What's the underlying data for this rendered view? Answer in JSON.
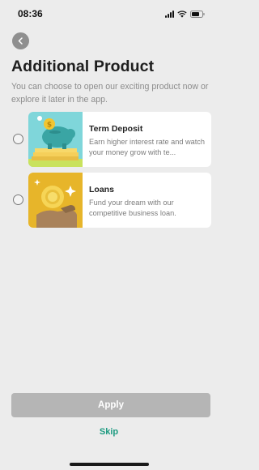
{
  "status_bar": {
    "time": "08:36"
  },
  "header": {
    "title": "Additional Product",
    "subtitle": "You can choose to open our exciting product now or explore it later in the app."
  },
  "products": [
    {
      "title": "Term Deposit",
      "description": "Earn higher interest rate and watch your money grow with te..."
    },
    {
      "title": "Loans",
      "description": "Fund your dream with our competitive business loan."
    }
  ],
  "actions": {
    "apply_label": "Apply",
    "skip_label": "Skip"
  },
  "colors": {
    "accent": "#1c9a80",
    "apply_disabled": "#b5b5b5",
    "background": "#ececec"
  }
}
